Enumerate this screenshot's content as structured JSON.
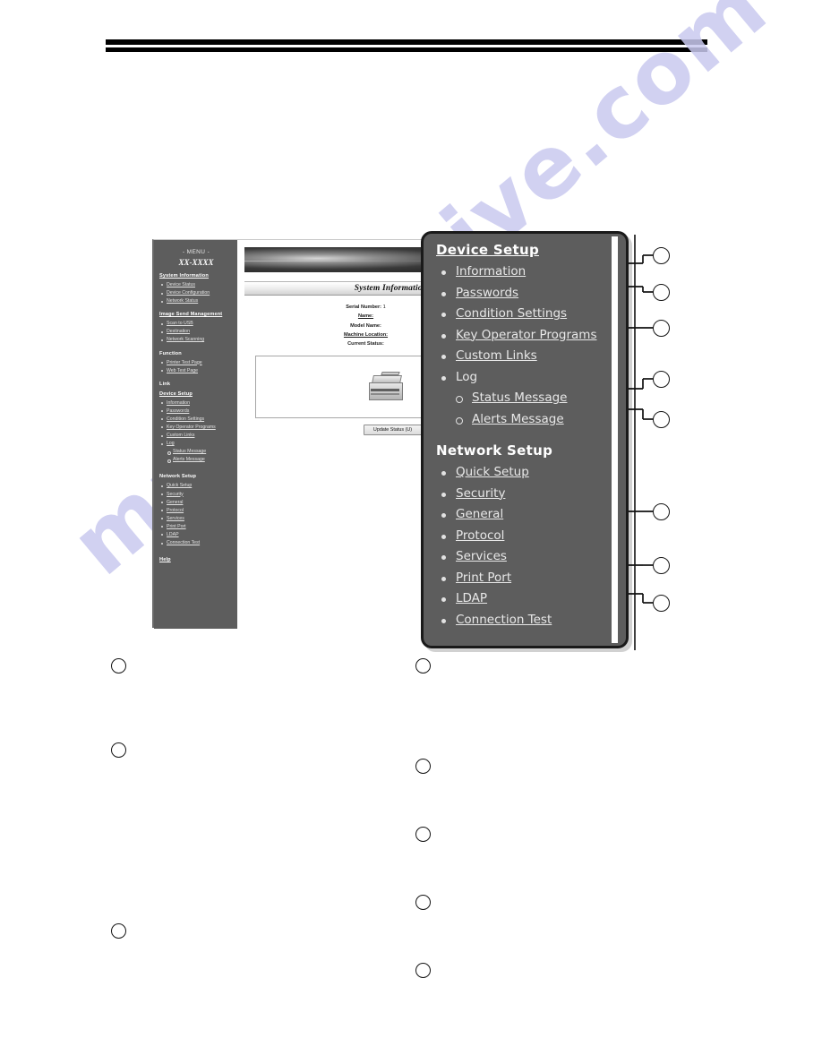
{
  "watermark": {
    "text": "manualshive.com"
  },
  "browser": {
    "sidebar": {
      "menu_label": "- MENU -",
      "model": "XX-XXXX",
      "groups": [
        {
          "title": "System Information",
          "items": [
            "Device Status",
            "Device Configuration",
            "Network Status"
          ]
        },
        {
          "title": "Image Send Management",
          "items": [
            "Scan to USB",
            "Destination",
            "Network Scanning"
          ]
        },
        {
          "title": "Function",
          "items": [
            "Printer Test Page",
            "Web Test Page"
          ]
        },
        {
          "title": "Link",
          "items": []
        },
        {
          "title": "Device Setup",
          "items": [
            "Information",
            "Passwords",
            "Condition Settings",
            "Key Operator Programs",
            "Custom Links",
            "Log"
          ],
          "subitems": [
            "Status Message",
            "Alerts Message"
          ]
        },
        {
          "title": "Network Setup",
          "items": [
            "Quick Setup",
            "Security",
            "General",
            "Protocol",
            "Services",
            "Print Port",
            "LDAP",
            "Connection Test"
          ]
        },
        {
          "title": "Help",
          "items": []
        }
      ]
    },
    "content": {
      "page_title": "System Information",
      "fields": [
        {
          "label": "Serial Number:",
          "value": "1",
          "underline": false
        },
        {
          "label": "Name:",
          "value": "",
          "underline": true
        },
        {
          "label": "Model Name:",
          "value": "",
          "underline": false
        },
        {
          "label": "Machine Location:",
          "value": "",
          "underline": true
        },
        {
          "label": "Current Status:",
          "value": "",
          "underline": false
        }
      ],
      "update_button": "Update Status (U)"
    }
  },
  "zoom_panel": {
    "device_setup": {
      "heading": "Device Setup",
      "items": [
        "Information",
        "Passwords",
        "Condition Settings",
        "Key Operator Programs",
        "Custom Links",
        "Log"
      ],
      "subitems": [
        "Status Message",
        "Alerts Message"
      ]
    },
    "network_setup": {
      "heading": "Network Setup",
      "items": [
        "Quick Setup",
        "Security",
        "General",
        "Protocol",
        "Services",
        "Print Port",
        "LDAP",
        "Connection Test"
      ]
    }
  },
  "callouts": {
    "right": [
      "",
      "",
      "",
      "",
      "",
      "",
      "",
      ""
    ],
    "bottom_left": [
      "",
      "",
      ""
    ],
    "bottom_right": [
      "",
      "",
      "",
      "",
      ""
    ]
  }
}
